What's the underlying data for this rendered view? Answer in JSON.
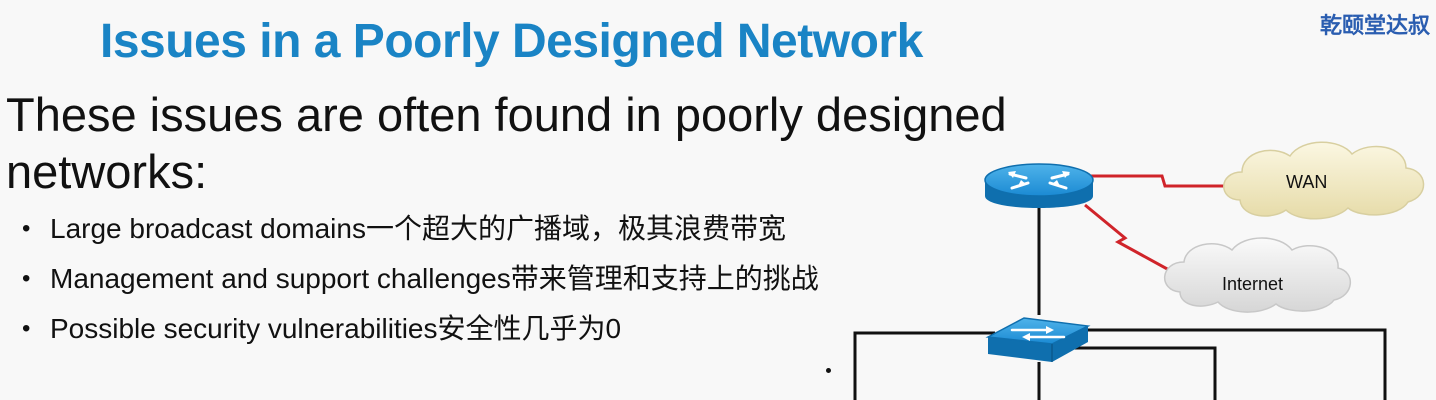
{
  "slide": {
    "title": "Issues in a Poorly Designed Network",
    "watermark": "乾颐堂达叔",
    "intro": "These issues are often found in poorly designed networks:",
    "bullets": [
      "Large broadcast domains一个超大的广播域，极其浪费带宽",
      "Management and support challenges带来管理和支持上的挑战",
      "Possible security vulnerabilities安全性几乎为0"
    ]
  },
  "diagram": {
    "wan_label": "WAN",
    "internet_label": "Internet",
    "icons": [
      "router-icon",
      "switch-icon",
      "wan-cloud-icon",
      "internet-cloud-icon"
    ],
    "colors": {
      "title": "#1a84c5",
      "device_blue": "#1b8ad3",
      "serial_link": "#d0242a",
      "wan_cloud": "#f3ecc8",
      "internet_cloud": "#e9e9e9"
    }
  }
}
